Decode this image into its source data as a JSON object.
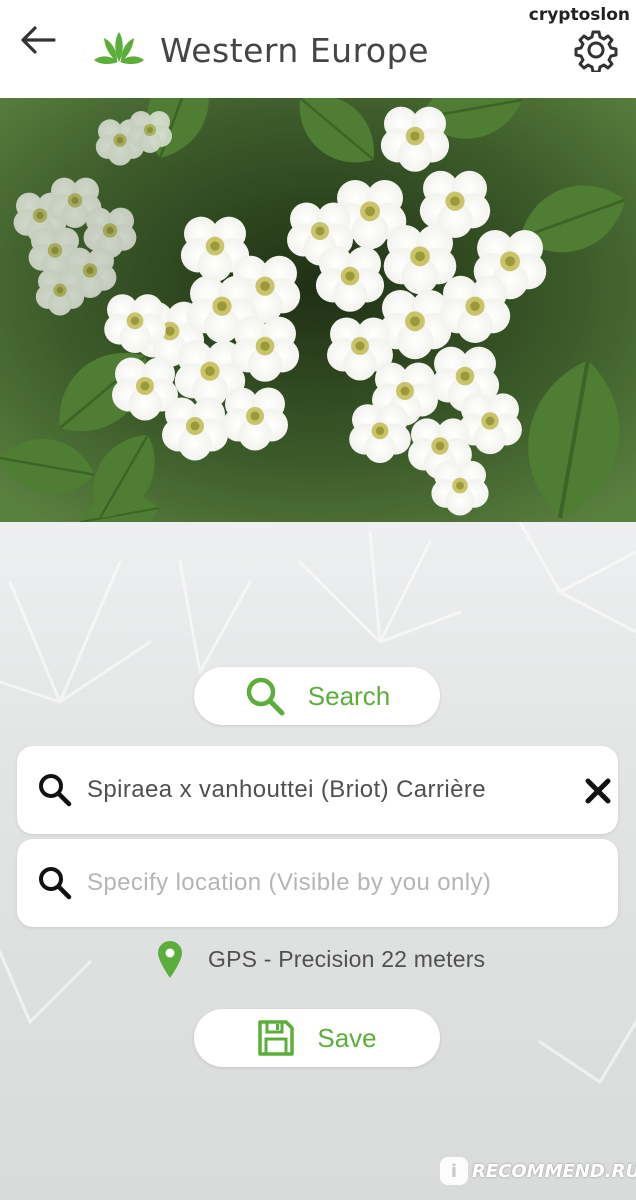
{
  "header": {
    "title": "Western Europe",
    "watermark": "cryptoslon"
  },
  "photo": {
    "subject": "white flower cluster photo"
  },
  "search_button": {
    "label": "Search"
  },
  "species_field": {
    "value": "Spiraea x vanhouttei (Briot) Carrière"
  },
  "location_field": {
    "placeholder": "Specify location (Visible by you only)"
  },
  "gps": {
    "text": "GPS - Precision 22 meters"
  },
  "save_button": {
    "label": "Save"
  },
  "footer_watermark": {
    "text": "RECOMMEND.RU",
    "badge": "i"
  },
  "colors": {
    "accent_green": "#5cae3a",
    "title_text": "#454545",
    "placeholder": "#b5b5b5"
  }
}
